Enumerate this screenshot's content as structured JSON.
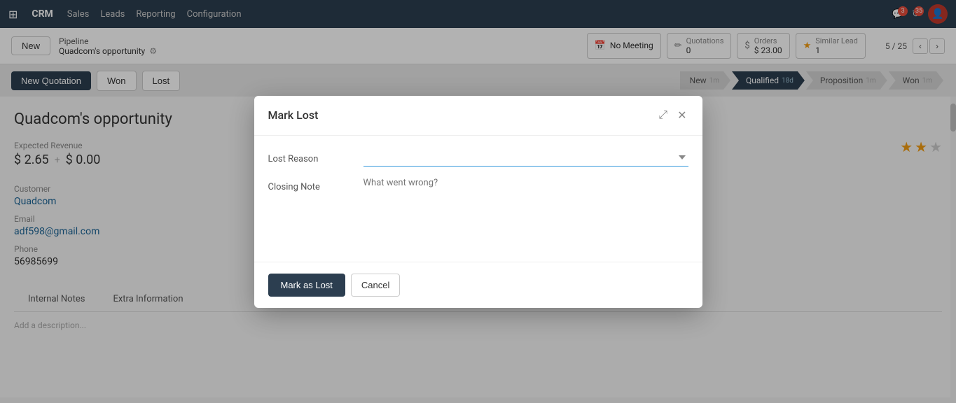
{
  "navbar": {
    "brand": "CRM",
    "menu": [
      "Sales",
      "Leads",
      "Reporting",
      "Configuration"
    ],
    "notifications_count": "3",
    "refresh_count": "35"
  },
  "subheader": {
    "new_label": "New",
    "breadcrumb_top": "Pipeline",
    "breadcrumb_bottom": "Quadcom's opportunity",
    "meeting_label": "No Meeting",
    "quotations_label": "Quotations",
    "quotations_count": "0",
    "orders_label": "Orders",
    "orders_value": "$ 23.00",
    "similar_lead_label": "Similar Lead",
    "similar_lead_count": "1",
    "record_count": "5 / 25"
  },
  "actionbar": {
    "new_quotation_label": "New Quotation",
    "won_label": "Won",
    "lost_label": "Lost",
    "stages": [
      {
        "label": "New",
        "duration": "1m",
        "active": false
      },
      {
        "label": "Qualified",
        "duration": "18d",
        "active": true
      },
      {
        "label": "Proposition",
        "duration": "1m",
        "active": false
      },
      {
        "label": "Won",
        "duration": "1m",
        "active": false
      }
    ]
  },
  "form": {
    "title": "Quadcom's opportunity",
    "expected_revenue_label": "Expected Revenue",
    "revenue_main": "$ 2.65",
    "revenue_plus": "+",
    "revenue_secondary": "$ 0.00",
    "customer_label": "Customer",
    "customer_value": "Quadcom",
    "email_label": "Email",
    "email_value": "adf598@gmail.com",
    "phone_label": "Phone",
    "phone_value": "56985699"
  },
  "tabs": [
    {
      "label": "Internal Notes",
      "active": false
    },
    {
      "label": "Extra Information",
      "active": false
    }
  ],
  "description_placeholder": "Add a description...",
  "modal": {
    "title": "Mark Lost",
    "lost_reason_label": "Lost Reason",
    "lost_reason_placeholder": "",
    "closing_note_label": "Closing Note",
    "closing_note_placeholder": "What went wrong?",
    "mark_as_lost_label": "Mark as Lost",
    "cancel_label": "Cancel"
  }
}
